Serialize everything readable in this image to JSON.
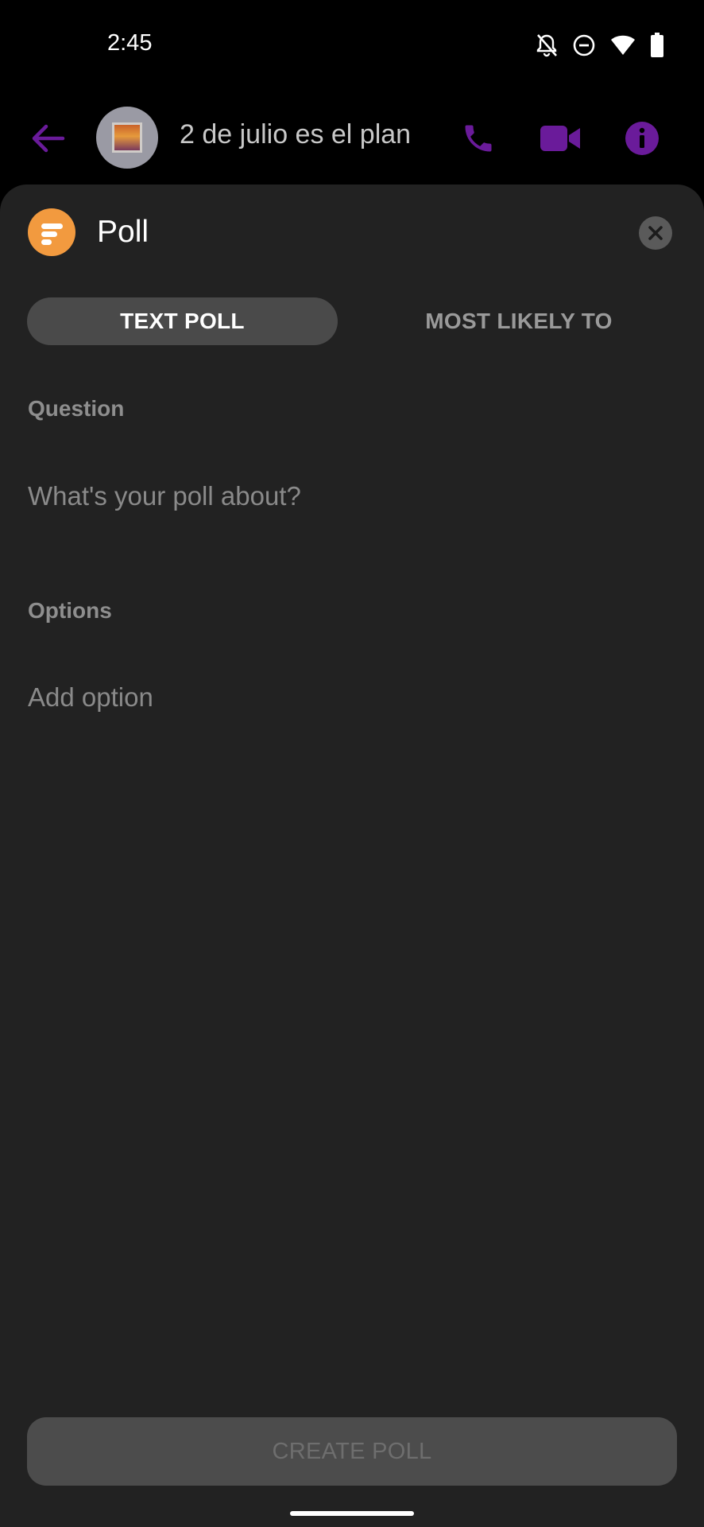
{
  "status_bar": {
    "time": "2:45",
    "icons": [
      "notifications-off-icon",
      "do-not-disturb-icon",
      "wifi-icon",
      "battery-icon"
    ]
  },
  "chat_header": {
    "title": "2 de julio es el plan",
    "icons": [
      "back-arrow-icon",
      "phone-icon",
      "video-camera-icon",
      "info-icon"
    ],
    "accent_color": "#6a1b9a"
  },
  "poll": {
    "title": "Poll",
    "logo_color": "#f29a3f",
    "tabs": [
      {
        "label": "TEXT POLL",
        "selected": true
      },
      {
        "label": "MOST LIKELY TO",
        "selected": false
      }
    ],
    "question_label": "Question",
    "question_placeholder": "What's your poll about?",
    "options_label": "Options",
    "option_placeholder": "Add option",
    "create_button_label": "CREATE POLL"
  }
}
